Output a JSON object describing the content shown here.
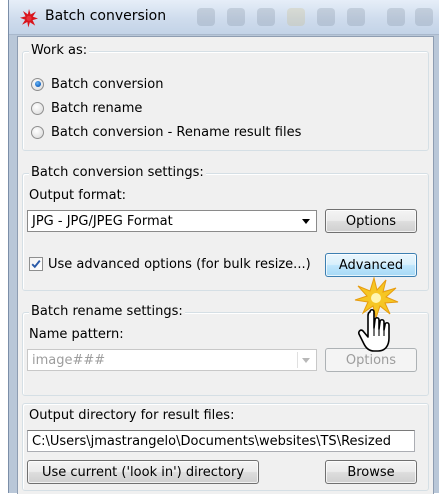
{
  "window": {
    "title": "Batch conversion",
    "icon": "app-splash-icon"
  },
  "work_as": {
    "label": "Work as:",
    "options": [
      {
        "label": "Batch conversion",
        "checked": true
      },
      {
        "label": "Batch rename",
        "checked": false
      },
      {
        "label": "Batch conversion - Rename result files",
        "checked": false
      }
    ]
  },
  "conversion": {
    "label": "Batch conversion settings:",
    "output_format_label": "Output format:",
    "output_format_value": "JPG - JPG/JPEG Format",
    "options_button": "Options",
    "advanced_checkbox_label": "Use advanced options (for bulk resize...)",
    "advanced_checked": true,
    "advanced_button": "Advanced"
  },
  "rename": {
    "label": "Batch rename settings:",
    "name_pattern_label": "Name pattern:",
    "name_pattern_value": "image###",
    "options_button": "Options"
  },
  "output": {
    "label": "Output directory for result files:",
    "directory_value": "C:\\Users\\jmastrangelo\\Documents\\websites\\TS\\Resized",
    "use_current_button": "Use current ('look in') directory",
    "browse_button": "Browse"
  },
  "colors": {
    "accent_radio": "#1f6fc9",
    "titlebar": "#cfdced",
    "client_bg": "#f0f0f0",
    "hover_button": "#bee6fd",
    "cursor_burst": "#f6c623"
  },
  "cursor": {
    "icon": "hand-pointer-icon",
    "effect": "click-burst-icon"
  }
}
